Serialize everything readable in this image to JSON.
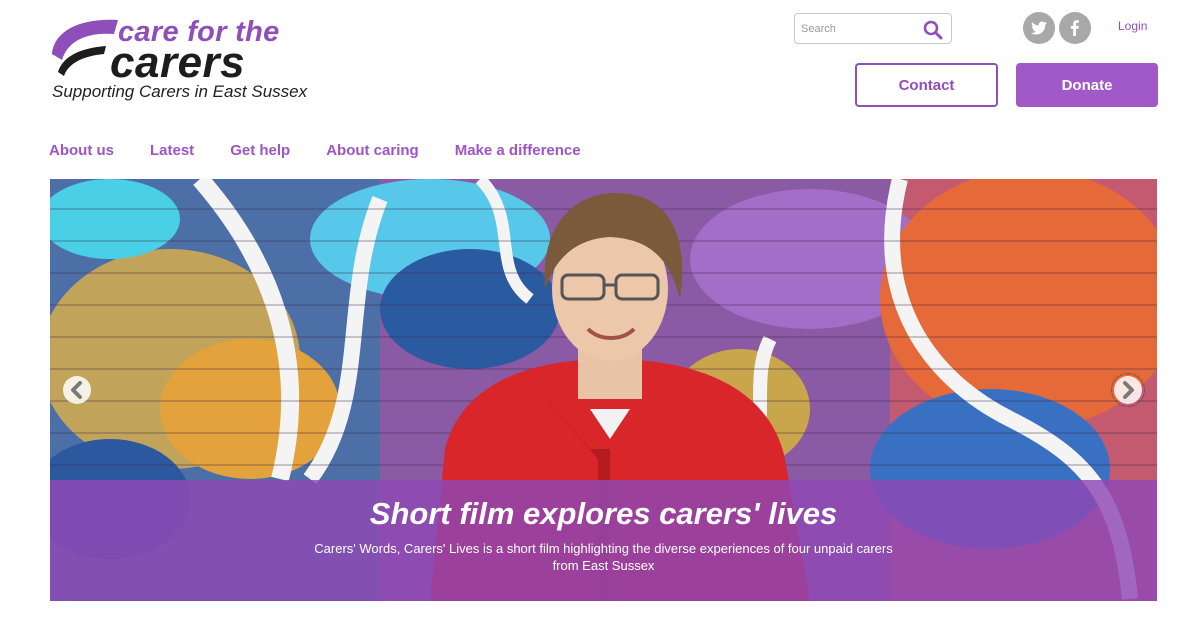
{
  "logo": {
    "line1": "care for the",
    "line2": "carers",
    "tagline": "Supporting Carers in East Sussex"
  },
  "search": {
    "placeholder": "Search",
    "icon": "search-icon"
  },
  "social": {
    "twitter_icon": "twitter-icon",
    "facebook_icon": "facebook-icon"
  },
  "header": {
    "login_label": "Login",
    "contact_label": "Contact",
    "donate_label": "Donate"
  },
  "nav": {
    "items": [
      "About us",
      "Latest",
      "Get help",
      "About caring",
      "Make a difference"
    ]
  },
  "hero": {
    "title": "Short film explores carers' lives",
    "text": "Carers' Words, Carers' Lives is a short film highlighting the diverse experiences of four unpaid carers from East Sussex",
    "prev_icon": "chevron-left-icon",
    "next_icon": "chevron-right-icon"
  },
  "colors": {
    "brand_purple": "#8f4fbb",
    "donate_bg": "#a159c8",
    "caption_overlay": "#8f48b4"
  }
}
